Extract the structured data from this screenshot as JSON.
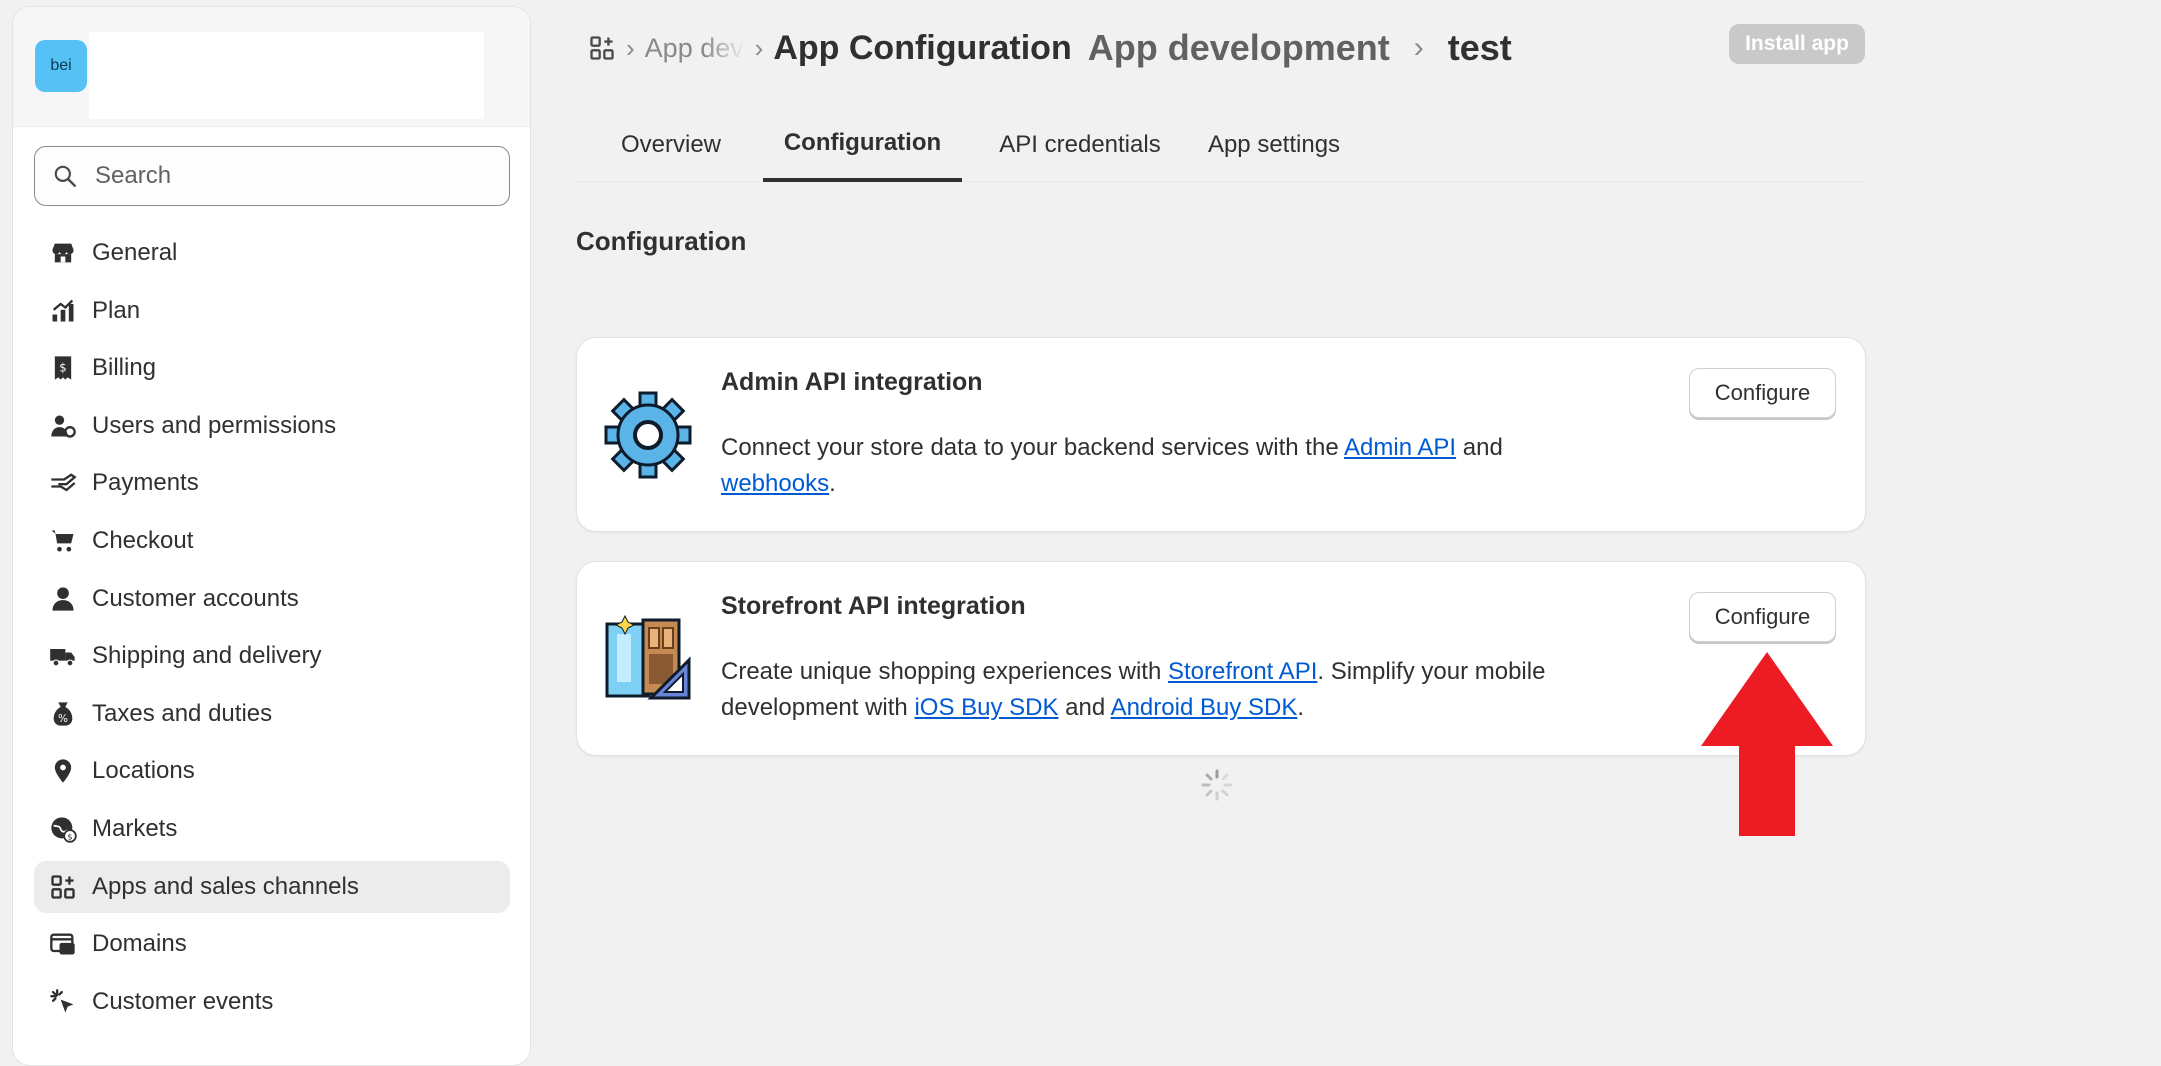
{
  "store": {
    "avatar_text": "bei"
  },
  "search": {
    "placeholder": "Search"
  },
  "sidebar": {
    "items": [
      {
        "label": "General",
        "icon": "store-icon"
      },
      {
        "label": "Plan",
        "icon": "plan-icon"
      },
      {
        "label": "Billing",
        "icon": "billing-icon"
      },
      {
        "label": "Users and permissions",
        "icon": "users-icon"
      },
      {
        "label": "Payments",
        "icon": "payments-icon"
      },
      {
        "label": "Checkout",
        "icon": "cart-icon"
      },
      {
        "label": "Customer accounts",
        "icon": "person-icon"
      },
      {
        "label": "Shipping and delivery",
        "icon": "truck-icon"
      },
      {
        "label": "Taxes and duties",
        "icon": "taxes-icon"
      },
      {
        "label": "Locations",
        "icon": "location-pin-icon"
      },
      {
        "label": "Markets",
        "icon": "globe-icon"
      },
      {
        "label": "Apps and sales channels",
        "icon": "apps-icon",
        "active": true
      },
      {
        "label": "Domains",
        "icon": "domains-icon"
      },
      {
        "label": "Customer events",
        "icon": "cursor-click-icon"
      }
    ]
  },
  "breadcrumb": {
    "faded": "App dev",
    "current": "App Configuration",
    "parent": "App development",
    "title": "test"
  },
  "header": {
    "install_label": "Install app"
  },
  "tabs": [
    {
      "label": "Overview"
    },
    {
      "label": "Configuration",
      "active": true
    },
    {
      "label": "API credentials"
    },
    {
      "label": "App settings"
    }
  ],
  "section": {
    "title": "Configuration"
  },
  "cards": [
    {
      "title": "Admin API integration",
      "icon": "gear-icon",
      "desc_before": "Connect your store data to your backend services with the ",
      "link1": "Admin API",
      "desc_mid": " and ",
      "link2": "webhooks",
      "desc_after": ".",
      "button": "Configure"
    },
    {
      "title": "Storefront API integration",
      "icon": "storefront-icon",
      "desc_before": "Create unique shopping experiences with ",
      "link1": "Storefront API",
      "desc_mid": ". Simplify your mobile development with ",
      "link2": "iOS Buy SDK",
      "desc_mid2": " and ",
      "link3": "Android Buy SDK",
      "desc_after": ".",
      "button": "Configure"
    }
  ],
  "colors": {
    "link": "#005bd3",
    "annotation_arrow": "#ed1c24",
    "avatar": "#56c1f5"
  }
}
